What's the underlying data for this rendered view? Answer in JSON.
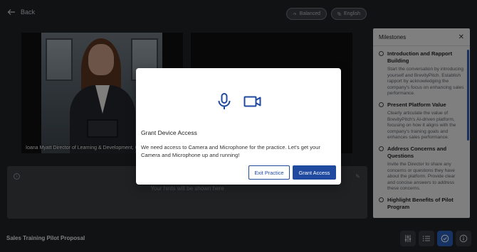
{
  "header": {
    "back_label": "Back",
    "balanced_label": "Balanced",
    "english_label": "English"
  },
  "video": {
    "caption": "Ioana Myatt Director of Learning & Development, G"
  },
  "hints": {
    "placeholder": "Your hints will be shown here"
  },
  "footer": {
    "title": "Sales Training Pilot Proposal"
  },
  "milestones": {
    "title": "Milestones",
    "close_symbol": "✕",
    "items": [
      {
        "title": "Introduction and Rapport Building",
        "desc": "Start the conversation by introducing yourself and BrevityPitch. Establish rapport by acknowledging the company's focus on enhancing sales performance."
      },
      {
        "title": "Present Platform Value",
        "desc": "Clearly articulate the value of BrevityPitch's AI-driven platform, focusing on how it aligns with the company's training goals and enhances sales performance."
      },
      {
        "title": "Address Concerns and Questions",
        "desc": "Invite the Director to share any concerns or questions they have about the platform. Provide clear and concise answers to address these concerns."
      },
      {
        "title": "Highlight Benefits of Pilot Program",
        "desc": ""
      }
    ]
  },
  "modal": {
    "title": "Grant Device Access",
    "message": "We need access to Camera and Microphone for the practice. Let's get your Camera and Microphone up and running!",
    "exit_label": "Exit Practice",
    "grant_label": "Grant Access",
    "accent": "#1f4aa0"
  }
}
